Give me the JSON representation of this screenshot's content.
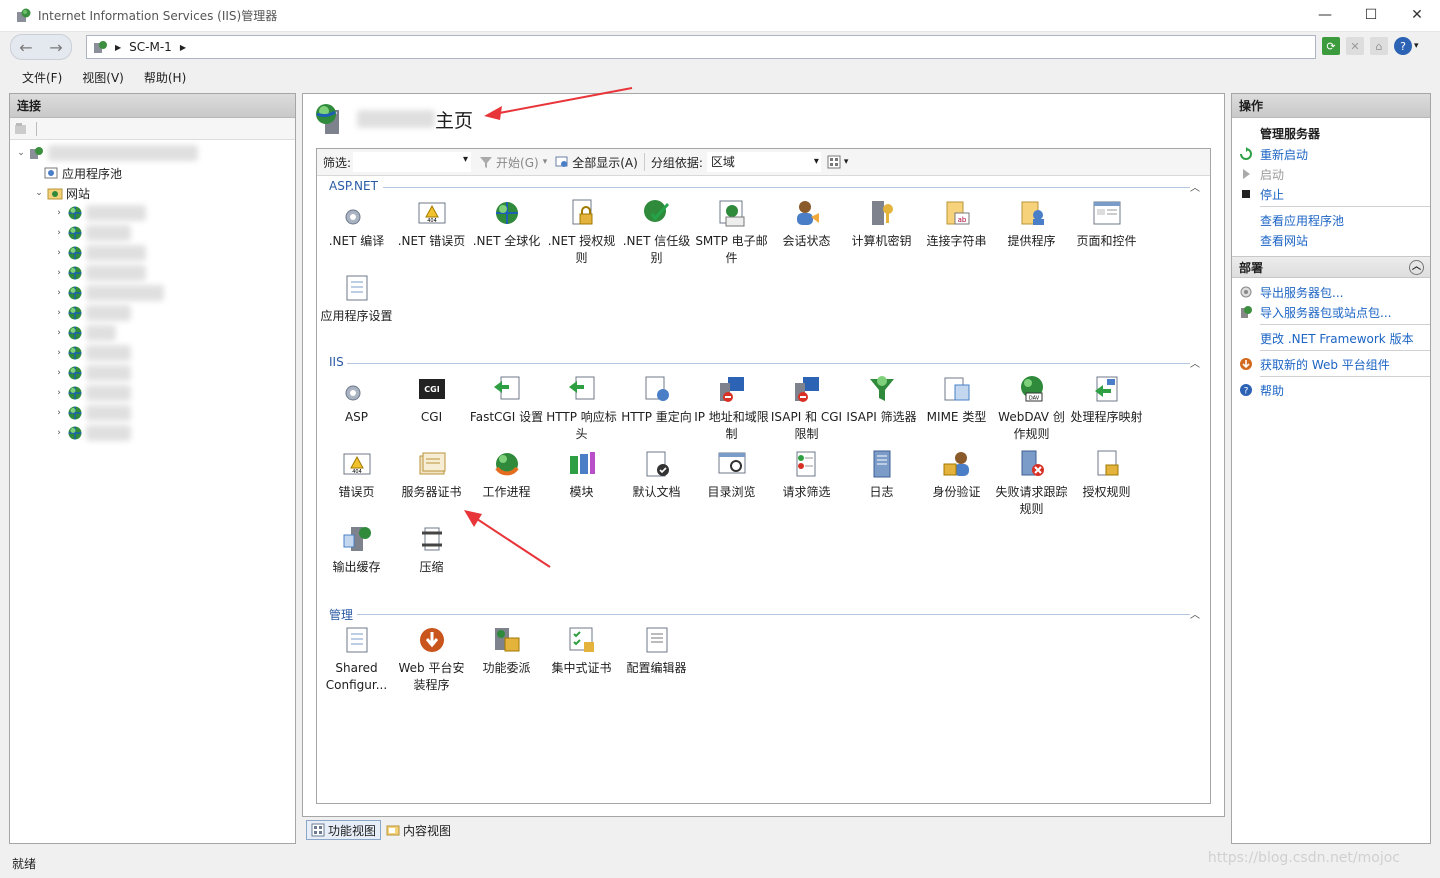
{
  "window": {
    "title": "Internet Information Services (IIS)管理器"
  },
  "address": {
    "segments": [
      "SC-M-1"
    ]
  },
  "menu": [
    "文件(F)",
    "视图(V)",
    "帮助(H)"
  ],
  "connections": {
    "title": "连接",
    "tree": {
      "app_pools": "应用程序池",
      "sites": "网站"
    }
  },
  "center": {
    "title_suffix": "主页",
    "filter_label": "筛选:",
    "start_label": "开始(G)",
    "show_all_label": "全部显示(A)",
    "group_by_label": "分组依据:",
    "group_by_value": "区域",
    "groups": [
      {
        "name": "ASP.NET",
        "items": [
          ".NET 编译",
          ".NET 错误页",
          ".NET 全球化",
          ".NET 授权规则",
          ".NET 信任级别",
          "SMTP 电子邮件",
          "会话状态",
          "计算机密钥",
          "连接字符串",
          "提供程序",
          "页面和控件",
          "应用程序设置"
        ]
      },
      {
        "name": "IIS",
        "items": [
          "ASP",
          "CGI",
          "FastCGI 设置",
          "HTTP 响应标头",
          "HTTP 重定向",
          "IP 地址和域限制",
          "ISAPI 和 CGI 限制",
          "ISAPI 筛选器",
          "MIME 类型",
          "WebDAV 创作规则",
          "处理程序映射",
          "错误页",
          "服务器证书",
          "工作进程",
          "模块",
          "默认文档",
          "目录浏览",
          "请求筛选",
          "日志",
          "身份验证",
          "失败请求跟踪规则",
          "授权规则",
          "输出缓存",
          "压缩"
        ]
      },
      {
        "name": "管理",
        "items": [
          "Shared Configur...",
          "Web 平台安装程序",
          "功能委派",
          "集中式证书",
          "配置编辑器"
        ]
      }
    ]
  },
  "view_tabs": {
    "features": "功能视图",
    "content": "内容视图"
  },
  "actions": {
    "title": "操作",
    "manage_server": "管理服务器",
    "restart": "重新启动",
    "start": "启动",
    "stop": "停止",
    "view_app_pools": "查看应用程序池",
    "view_sites": "查看网站",
    "deploy": "部署",
    "export_pkg": "导出服务器包...",
    "import_pkg": "导入服务器包或站点包...",
    "change_net": "更改 .NET Framework 版本",
    "get_web": "获取新的 Web 平台组件",
    "help": "帮助"
  },
  "status": {
    "text": "就绪"
  },
  "watermark": "https://blog.csdn.net/mojoc",
  "colors": {
    "link": "#1c64c4",
    "arrow": "#e8353a",
    "group_head": "#2a5aa3"
  }
}
